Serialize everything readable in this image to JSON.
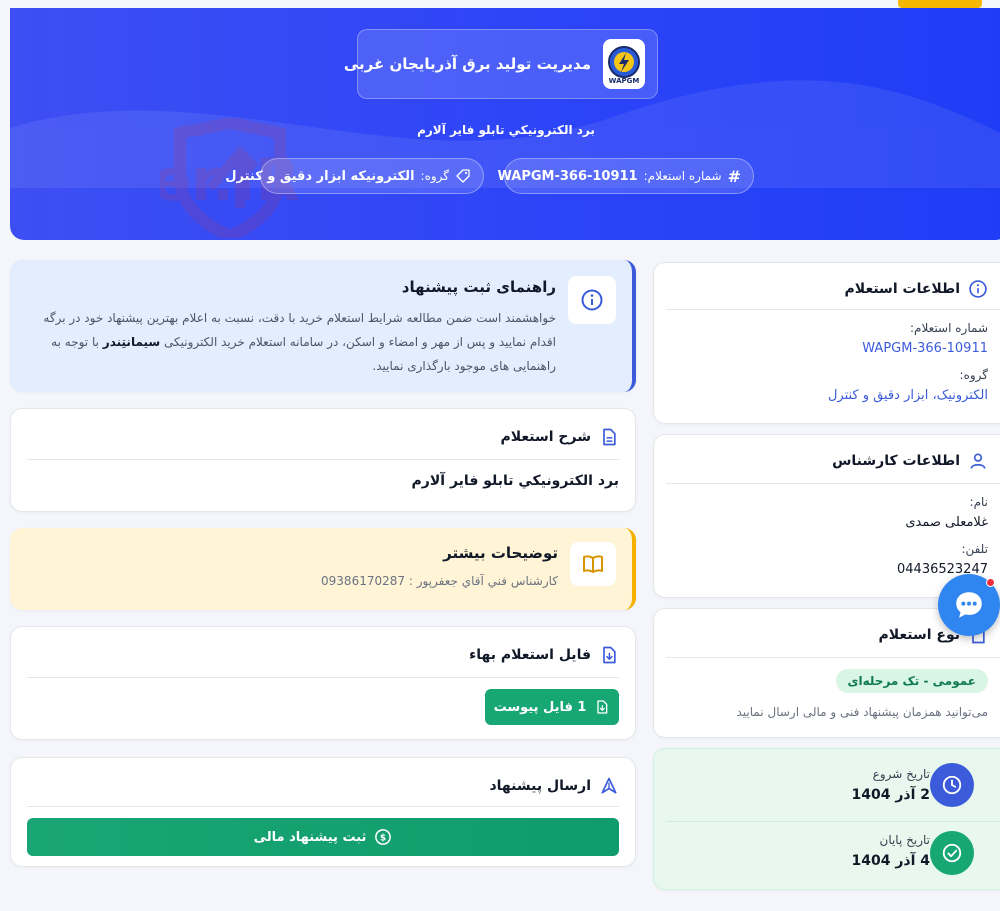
{
  "header": {
    "org_name": "مدیریت تولید برق آذربایجان غربی",
    "logo_text": "WAPGM",
    "subtitle": "برد الکترونيکي تابلو فاير آلارم",
    "number_label": "شماره استعلام:",
    "number_value": "WAPGM-366-10911",
    "group_label": "گروه:",
    "group_value": "الکترونیکه ابزار دقیق و کنترل",
    "watermark_text": "AriaTender.IR",
    "brand_colors": {
      "primary": "#2b43f8",
      "accent": "#f5b800",
      "success": "#16a774"
    }
  },
  "guide": {
    "title": "راهنمای ثبت پیشنهاد",
    "text_part1": "خواهشمند است ضمن مطالعه شرایط استعلام خرید با دقت، نسبت به اعلام بهترین پیشنهاد خود در برگه اقدام نمایید و پس از مهر و امضاء و اسکن، در سامانه استعلام خرید الکترونیکی",
    "text_brand": "سیمانتِندر",
    "text_part2": "با توجه به راهنمایی های موجود بارگذاری نمایید."
  },
  "description": {
    "title": "شرح استعلام",
    "value": "برد الکترونيکي تابلو فاير آلارم"
  },
  "more_info": {
    "title": "توضیحات بیشتر",
    "text": "کارشناس فني آقاي جعفرپور : 09386170287"
  },
  "file": {
    "title": "فایل استعلام بهاء",
    "button_label": "1 فایل پیوست"
  },
  "send": {
    "title": "ارسال پیشنهاد",
    "button_label": "ثبت پیشنهاد مالی"
  },
  "inquiry_info": {
    "title": "اطلاعات استعلام",
    "number_label": "شماره استعلام:",
    "number_value": "WAPGM-366-10911",
    "group_label": "گروه:",
    "group_value": "الکترونیک، ابزار دقیق و کنترل"
  },
  "expert_info": {
    "title": "اطلاعات کارشناس",
    "name_label": "نام:",
    "name_value": "غلامعلی صمدی",
    "phone_label": "تلفن:",
    "phone_value": "04436523247"
  },
  "inquiry_type": {
    "title": "نوع استعلام",
    "badge": "عمومی - تک مرحله‌ای",
    "note": "می‌توانید همزمان پیشنهاد فنی و مالی ارسال نمایید"
  },
  "dates": {
    "start_label": "تاریخ شروع",
    "start_value": "2 آذر 1404",
    "end_label": "تاریخ پایان",
    "end_value": "4 آذر 1404"
  }
}
